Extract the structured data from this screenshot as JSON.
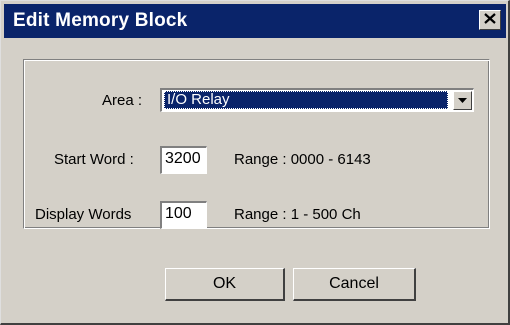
{
  "dialog": {
    "title": "Edit Memory Block",
    "close_label": "✕"
  },
  "fields": {
    "area_label": "Area :",
    "area_value": "I/O Relay",
    "start_word_label": "Start Word :",
    "start_word_value": "3200",
    "start_word_range": "Range : 0000 - 6143",
    "display_words_label": "Display Words",
    "display_words_value": "100",
    "display_words_range": "Range : 1 - 500 Ch"
  },
  "buttons": {
    "ok_label": "OK",
    "cancel_label": "Cancel"
  },
  "colors": {
    "titlebar": "#0a246a",
    "face": "#d4d0c8",
    "selection": "#0a246a"
  },
  "icons": {
    "close": "close-icon",
    "dropdown": "chevron-down-icon"
  }
}
